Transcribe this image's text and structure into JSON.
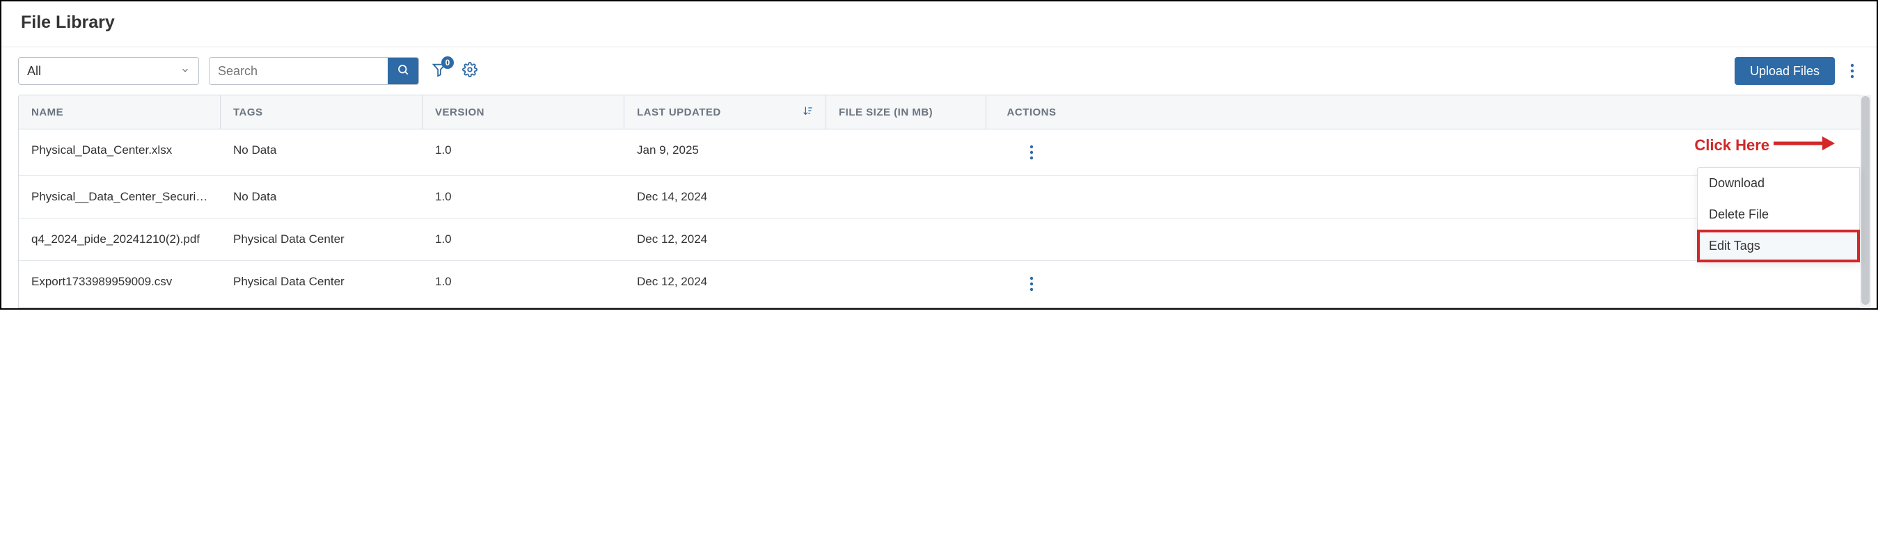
{
  "header": {
    "title": "File Library"
  },
  "toolbar": {
    "filter_value": "All",
    "search_placeholder": "Search",
    "filter_badge": "0",
    "upload_label": "Upload Files"
  },
  "columns": {
    "name": "NAME",
    "tags": "TAGS",
    "version": "VERSION",
    "updated": "LAST UPDATED",
    "size": "FILE SIZE (IN MB)",
    "actions": "ACTIONS"
  },
  "rows": [
    {
      "name": "Physical_Data_Center.xlsx",
      "tags": "No Data",
      "version": "1.0",
      "updated": "Jan 9, 2025",
      "size": ""
    },
    {
      "name": "Physical__Data_Center_Security...",
      "tags": "No Data",
      "version": "1.0",
      "updated": "Dec 14, 2024",
      "size": ""
    },
    {
      "name": "q4_2024_pide_20241210(2).pdf",
      "tags": "Physical Data Center",
      "version": "1.0",
      "updated": "Dec 12, 2024",
      "size": ""
    },
    {
      "name": "Export1733989959009.csv",
      "tags": "Physical Data Center",
      "version": "1.0",
      "updated": "Dec 12, 2024",
      "size": ""
    }
  ],
  "menu": {
    "download": "Download",
    "delete": "Delete File",
    "edit_tags": "Edit Tags"
  },
  "annotation": {
    "text": "Click Here"
  }
}
